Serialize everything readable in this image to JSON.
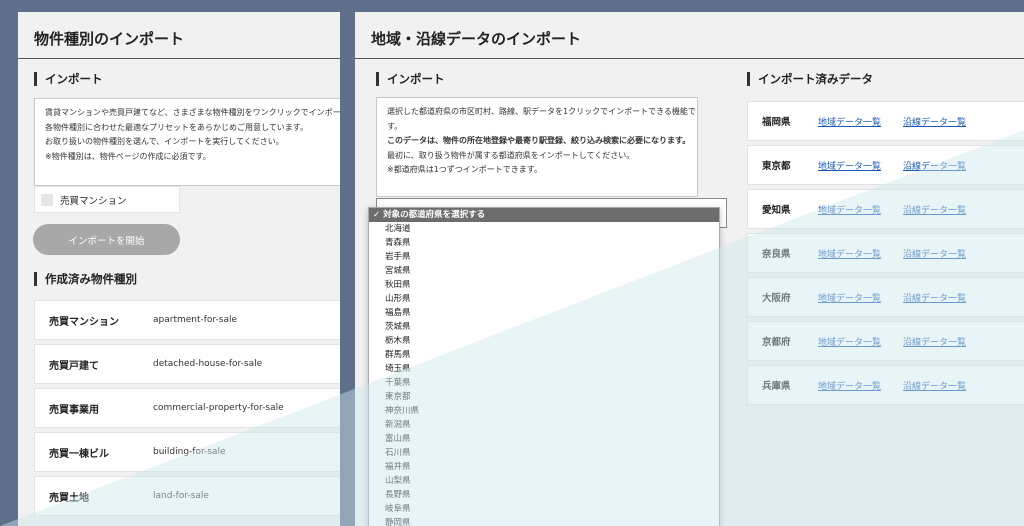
{
  "left": {
    "title": "物件種別のインポート",
    "import_heading": "インポート",
    "notice_lines": [
      "賃貸マンションや売買戸建てなど、さまざまな物件種別をワンクリックでインポー",
      "各物件種別に合わせた最適なプリセットをあらかじめご用意しています。",
      "お取り扱いの物件種別を選んで、インポートを実行してください。",
      "※物件種別は、物件ページの作成に必須です。"
    ],
    "checkbox_label": "売買マンション",
    "start_button": "インポートを開始",
    "created_heading": "作成済み物件種別",
    "rows": [
      {
        "name": "売買マンション",
        "slug": "apartment-for-sale"
      },
      {
        "name": "売買戸建て",
        "slug": "detached-house-for-sale"
      },
      {
        "name": "売買事業用",
        "slug": "commercial-property-for-sale"
      },
      {
        "name": "売買一棟ビル",
        "slug": "building-for-sale"
      },
      {
        "name": "売買土地",
        "slug": "land-for-sale"
      }
    ]
  },
  "right": {
    "title": "地域・沿線データのインポート",
    "import_heading": "インポート",
    "notice_lines": [
      "選択した都道府県の市区町村、路線、駅データを1クリックでインポートできる機能で",
      "す。",
      "このデータは、物件の所在地登録や最寄り駅登録、絞り込み検索に必要になります。",
      "最初に、取り扱う物件が属する都道府県をインポートしてください。",
      "※都道府県は1つずつインポートできます。"
    ],
    "done_heading": "インポート済みデータ",
    "area_link": "地域データ一覧",
    "line_link": "沿線データ一覧",
    "prefectures": [
      "福岡県",
      "東京都",
      "愛知県",
      "奈良県",
      "大阪府",
      "京都府",
      "兵庫県"
    ]
  },
  "dropdown": {
    "selected": "✓ 対象の都道府県を選択する",
    "options": [
      "北海道",
      "青森県",
      "岩手県",
      "宮城県",
      "秋田県",
      "山形県",
      "福島県",
      "茨城県",
      "栃木県",
      "群馬県",
      "埼玉県",
      "千葉県",
      "東京都",
      "神奈川県",
      "新潟県",
      "富山県",
      "石川県",
      "福井県",
      "山梨県",
      "長野県",
      "岐阜県",
      "静岡県"
    ]
  }
}
